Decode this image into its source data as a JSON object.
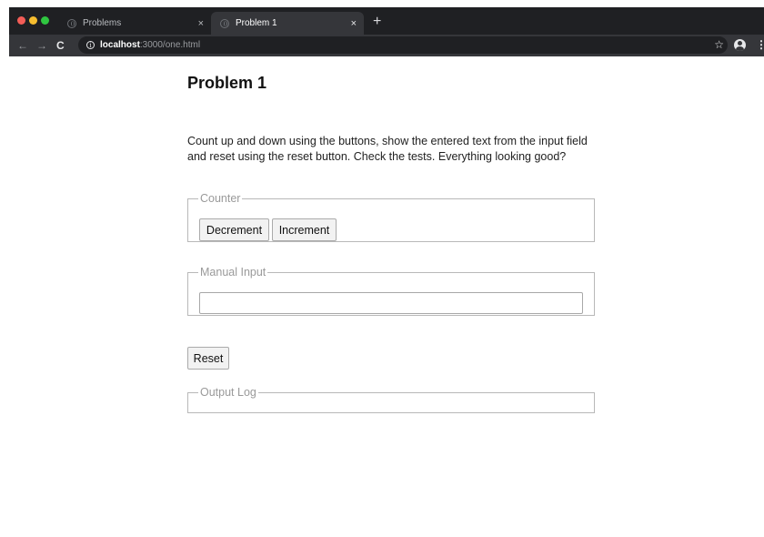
{
  "browser": {
    "tabs": [
      {
        "label": "Problems",
        "active": false
      },
      {
        "label": "Problem 1",
        "active": true
      }
    ],
    "new_tab_symbol": "+",
    "close_symbol": "×",
    "url_host": "localhost",
    "url_rest": ":3000/one.html",
    "nav_icons": [
      "back-arrow-icon",
      "forward-arrow-icon",
      "reload-icon",
      "info-icon",
      "star-icon",
      "profile-icon",
      "menu-icon"
    ]
  },
  "page": {
    "title": "Problem 1",
    "description": "Count up and down using the buttons, show the entered text from the input field and reset using the reset button. Check the tests. Everything looking good?",
    "counter": {
      "legend": "Counter",
      "decrement_label": "Decrement",
      "increment_label": "Increment"
    },
    "manual_input": {
      "legend": "Manual Input",
      "value": "",
      "placeholder": ""
    },
    "reset_label": "Reset",
    "output_log": {
      "legend": "Output Log"
    }
  }
}
